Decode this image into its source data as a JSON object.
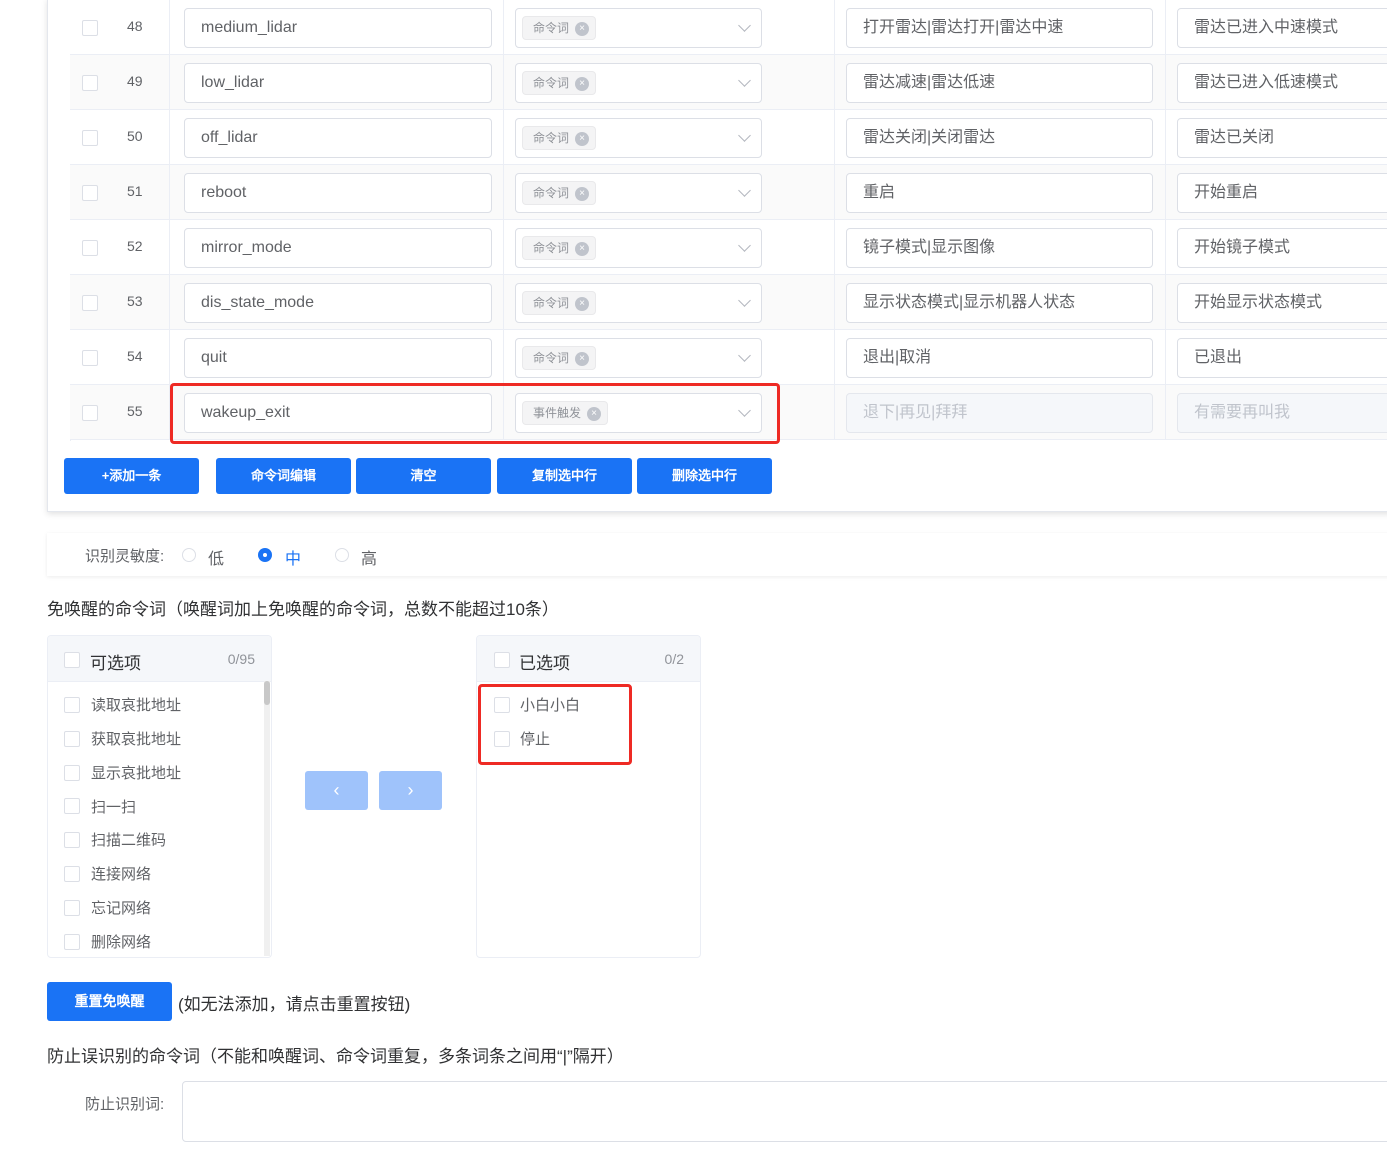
{
  "rows": [
    {
      "index": "48",
      "key": "medium_lidar",
      "type_tag": "命令词",
      "phrases": "打开雷达|雷达打开|雷达中速",
      "reply": "雷达已进入中速模式"
    },
    {
      "index": "49",
      "key": "low_lidar",
      "type_tag": "命令词",
      "phrases": "雷达减速|雷达低速",
      "reply": "雷达已进入低速模式"
    },
    {
      "index": "50",
      "key": "off_lidar",
      "type_tag": "命令词",
      "phrases": "雷达关闭|关闭雷达",
      "reply": "雷达已关闭"
    },
    {
      "index": "51",
      "key": "reboot",
      "type_tag": "命令词",
      "phrases": "重启",
      "reply": "开始重启"
    },
    {
      "index": "52",
      "key": "mirror_mode",
      "type_tag": "命令词",
      "phrases": "镜子模式|显示图像",
      "reply": "开始镜子模式"
    },
    {
      "index": "53",
      "key": "dis_state_mode",
      "type_tag": "命令词",
      "phrases": "显示状态模式|显示机器人状态",
      "reply": "开始显示状态模式"
    },
    {
      "index": "54",
      "key": "quit",
      "type_tag": "命令词",
      "phrases": "退出|取消",
      "reply": "已退出"
    },
    {
      "index": "55",
      "key": "wakeup_exit",
      "type_tag": "事件触发",
      "phrases_placeholder": "退下|再见|拜拜",
      "reply_placeholder": "有需要再叫我"
    }
  ],
  "toolbar": {
    "add": "+添加一条",
    "edit": "命令词编辑",
    "clear": "清空",
    "copy": "复制选中行",
    "delete": "删除选中行"
  },
  "sensitivity": {
    "label": "识别灵敏度:",
    "options": [
      "低",
      "中",
      "高"
    ],
    "selected": "中"
  },
  "wakefree": {
    "heading": "免唤醒的命令词（唤醒词加上免唤醒的命令词，总数不能超过10条）",
    "available": {
      "title": "可选项",
      "count": "0/95",
      "items": [
        "读取哀批地址",
        "获取哀批地址",
        "显示哀批地址",
        "扫一扫",
        "扫描二维码",
        "连接网络",
        "忘记网络",
        "删除网络"
      ]
    },
    "selected": {
      "title": "已选项",
      "count": "0/2",
      "items": [
        "小白小白",
        "停止"
      ]
    },
    "left_arrow": "‹",
    "right_arrow": "›",
    "reset_button": "重置免唤醒",
    "reset_hint": "(如无法添加，请点击重置按钮)"
  },
  "misrecog": {
    "heading": "防止误识别的命令词（不能和唤醒词、命令词重复，多条词条之间用“|”隔开）",
    "label": "防止识别词:",
    "value": ""
  },
  "colors": {
    "primary": "#1a73f5",
    "primary_disabled": "#9fc3fb",
    "highlight": "#ee2a24"
  }
}
